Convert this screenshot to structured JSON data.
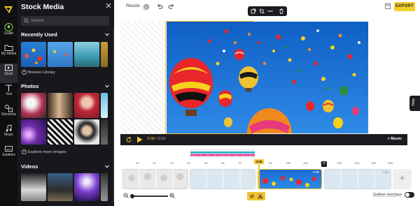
{
  "app": {
    "title": "Stock Media"
  },
  "rail": {
    "items": [
      {
        "label": "Guide",
        "icon": "lightbulb-icon"
      },
      {
        "label": "My Media",
        "icon": "folder-icon"
      },
      {
        "label": "Stock",
        "icon": "stock-film-icon"
      },
      {
        "label": "Text",
        "icon": "text-icon"
      },
      {
        "label": "Elements",
        "icon": "shapes-icon"
      },
      {
        "label": "Music",
        "icon": "music-note-icon"
      },
      {
        "label": "Subtitles",
        "icon": "subtitles-icon"
      }
    ]
  },
  "panel": {
    "title": "Stock Media",
    "search_placeholder": "Search",
    "recently_used": {
      "title": "Recently Used",
      "link": "Browse Library"
    },
    "photos": {
      "title": "Photos",
      "link": "Explore more images"
    },
    "videos": {
      "title": "Videos"
    }
  },
  "toolbar": {
    "resize_label": "Resize",
    "export_label": "EXPORT"
  },
  "player": {
    "current_time": "0:08",
    "separator": "/",
    "duration": "0:16",
    "music_label": "+ Music"
  },
  "timeline": {
    "ticks": [
      "1s",
      "2s",
      "3s",
      "4s",
      "5s",
      "6s",
      "7s",
      "8s",
      "9s",
      "10s",
      "11s",
      "12s",
      "13s",
      "14s",
      "15s",
      "16s"
    ],
    "playhead_label": "0:08",
    "clip_durations": [
      "",
      "",
      "0:06",
      "0:06"
    ]
  },
  "bottom": {
    "gather_label": "Gather overlays"
  },
  "colors": {
    "accent": "#f1c232",
    "panel_bg": "#18181c",
    "rail_bg": "#0f0f12",
    "sky": "#1a78d6"
  }
}
